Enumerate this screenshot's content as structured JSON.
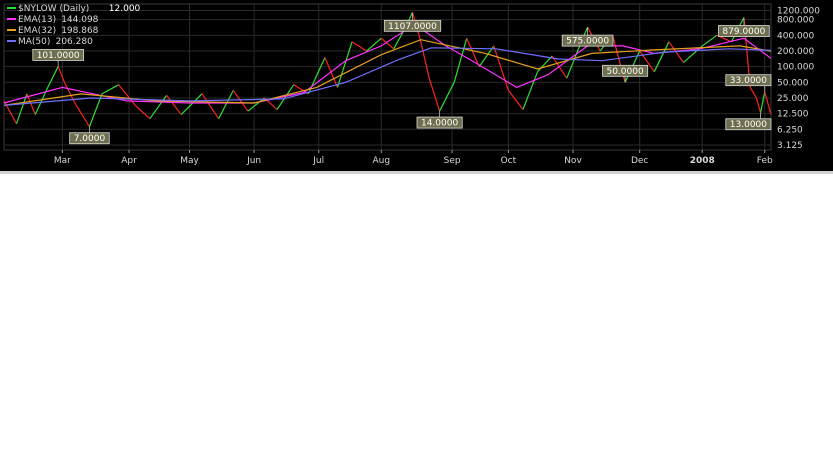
{
  "chart_data": {
    "type": "line",
    "title": "$NYLOW (Daily)",
    "last_value": "12.000",
    "y_scale": "log",
    "ylim": [
      2.5,
      1600
    ],
    "y_ticks": [
      {
        "value": 1200,
        "label": "1200.000"
      },
      {
        "value": 800,
        "label": "800.000"
      },
      {
        "value": 400,
        "label": "400.000"
      },
      {
        "value": 200,
        "label": "200.000"
      },
      {
        "value": 100,
        "label": "100.000"
      },
      {
        "value": 50,
        "label": "50.000"
      },
      {
        "value": 25,
        "label": "25.000"
      },
      {
        "value": 12.5,
        "label": "12.500"
      },
      {
        "value": 6.25,
        "label": "6.250"
      },
      {
        "value": 3.125,
        "label": "3.125"
      }
    ],
    "x_ticks": [
      {
        "date": "2007-03-01",
        "label": "Mar",
        "bold": false
      },
      {
        "date": "2007-04-02",
        "label": "Apr",
        "bold": false
      },
      {
        "date": "2007-05-01",
        "label": "May",
        "bold": false
      },
      {
        "date": "2007-06-01",
        "label": "Jun",
        "bold": false
      },
      {
        "date": "2007-07-02",
        "label": "Jul",
        "bold": false
      },
      {
        "date": "2007-08-01",
        "label": "Aug",
        "bold": false
      },
      {
        "date": "2007-09-04",
        "label": "Sep",
        "bold": false
      },
      {
        "date": "2007-10-01",
        "label": "Oct",
        "bold": false
      },
      {
        "date": "2007-11-01",
        "label": "Nov",
        "bold": false
      },
      {
        "date": "2007-12-03",
        "label": "Dec",
        "bold": false
      },
      {
        "date": "2008-01-02",
        "label": "2008",
        "bold": true
      },
      {
        "date": "2008-02-01",
        "label": "Feb",
        "bold": false
      }
    ],
    "xlim": [
      "2007-02-01",
      "2008-02-04"
    ],
    "legend": [
      {
        "name": "$NYLOW (Daily)",
        "value": "12.000",
        "color": "#2ee02e"
      },
      {
        "name": "EMA(13)",
        "value": "144.098",
        "color": "#ff30ff"
      },
      {
        "name": "EMA(32)",
        "value": "198.868",
        "color": "#e6a020"
      },
      {
        "name": "MA(50)",
        "value": "206.280",
        "color": "#7070ff"
      }
    ],
    "up_color": "#2ee02e",
    "down_color": "#ff2020",
    "annotations": [
      {
        "date": "2007-02-27",
        "value": 101,
        "label": "101.0000"
      },
      {
        "date": "2007-03-14",
        "value": 7,
        "label": "7.0000"
      },
      {
        "date": "2007-08-16",
        "value": 1107,
        "label": "1107.0000"
      },
      {
        "date": "2007-08-29",
        "value": 14,
        "label": "14.0000"
      },
      {
        "date": "2007-11-08",
        "value": 575,
        "label": "575.0000"
      },
      {
        "date": "2007-11-26",
        "value": 50,
        "label": "50.0000"
      },
      {
        "date": "2008-01-22",
        "value": 879,
        "label": "879.0000"
      },
      {
        "date": "2008-02-01",
        "value": 33,
        "label": "33.0000"
      },
      {
        "date": "2008-01-30",
        "value": 13,
        "label": "13.0000"
      }
    ],
    "series": [
      {
        "name": "$NYLOW (Daily)",
        "anchors": [
          [
            "2007-02-01",
            22
          ],
          [
            "2007-02-07",
            8
          ],
          [
            "2007-02-12",
            30
          ],
          [
            "2007-02-16",
            12
          ],
          [
            "2007-02-22",
            40
          ],
          [
            "2007-02-27",
            101
          ],
          [
            "2007-03-02",
            50
          ],
          [
            "2007-03-07",
            20
          ],
          [
            "2007-03-14",
            7
          ],
          [
            "2007-03-20",
            30
          ],
          [
            "2007-03-28",
            45
          ],
          [
            "2007-04-05",
            18
          ],
          [
            "2007-04-12",
            10
          ],
          [
            "2007-04-20",
            28
          ],
          [
            "2007-04-27",
            12
          ],
          [
            "2007-05-07",
            30
          ],
          [
            "2007-05-15",
            10
          ],
          [
            "2007-05-22",
            35
          ],
          [
            "2007-05-29",
            14
          ],
          [
            "2007-06-06",
            25
          ],
          [
            "2007-06-12",
            15
          ],
          [
            "2007-06-20",
            45
          ],
          [
            "2007-06-27",
            30
          ],
          [
            "2007-07-05",
            150
          ],
          [
            "2007-07-11",
            40
          ],
          [
            "2007-07-18",
            300
          ],
          [
            "2007-07-25",
            200
          ],
          [
            "2007-08-01",
            350
          ],
          [
            "2007-08-07",
            220
          ],
          [
            "2007-08-13",
            600
          ],
          [
            "2007-08-16",
            1107
          ],
          [
            "2007-08-20",
            300
          ],
          [
            "2007-08-24",
            60
          ],
          [
            "2007-08-29",
            14
          ],
          [
            "2007-09-05",
            50
          ],
          [
            "2007-09-11",
            350
          ],
          [
            "2007-09-17",
            100
          ],
          [
            "2007-09-24",
            250
          ],
          [
            "2007-10-01",
            35
          ],
          [
            "2007-10-08",
            15
          ],
          [
            "2007-10-15",
            80
          ],
          [
            "2007-10-22",
            160
          ],
          [
            "2007-10-29",
            60
          ],
          [
            "2007-11-05",
            300
          ],
          [
            "2007-11-08",
            575
          ],
          [
            "2007-11-14",
            200
          ],
          [
            "2007-11-20",
            400
          ],
          [
            "2007-11-26",
            50
          ],
          [
            "2007-12-03",
            200
          ],
          [
            "2007-12-10",
            80
          ],
          [
            "2007-12-17",
            300
          ],
          [
            "2007-12-24",
            120
          ],
          [
            "2008-01-02",
            250
          ],
          [
            "2008-01-09",
            400
          ],
          [
            "2008-01-16",
            300
          ],
          [
            "2008-01-22",
            879
          ],
          [
            "2008-01-25",
            40
          ],
          [
            "2008-01-28",
            25
          ],
          [
            "2008-01-30",
            13
          ],
          [
            "2008-02-01",
            33
          ],
          [
            "2008-02-04",
            12
          ]
        ]
      },
      {
        "name": "EMA(13)",
        "anchors": [
          [
            "2007-02-01",
            20
          ],
          [
            "2007-03-01",
            40
          ],
          [
            "2007-04-01",
            22
          ],
          [
            "2007-05-01",
            20
          ],
          [
            "2007-06-01",
            20
          ],
          [
            "2007-06-25",
            32
          ],
          [
            "2007-07-15",
            130
          ],
          [
            "2007-08-01",
            250
          ],
          [
            "2007-08-17",
            650
          ],
          [
            "2007-09-01",
            250
          ],
          [
            "2007-09-15",
            120
          ],
          [
            "2007-10-05",
            40
          ],
          [
            "2007-10-20",
            70
          ],
          [
            "2007-11-08",
            250
          ],
          [
            "2007-11-25",
            250
          ],
          [
            "2007-12-10",
            180
          ],
          [
            "2008-01-01",
            220
          ],
          [
            "2008-01-22",
            350
          ],
          [
            "2008-02-04",
            144
          ]
        ]
      },
      {
        "name": "EMA(32)",
        "anchors": [
          [
            "2007-02-01",
            18
          ],
          [
            "2007-03-10",
            30
          ],
          [
            "2007-04-15",
            22
          ],
          [
            "2007-06-01",
            20
          ],
          [
            "2007-07-01",
            40
          ],
          [
            "2007-08-01",
            170
          ],
          [
            "2007-08-20",
            330
          ],
          [
            "2007-09-20",
            180
          ],
          [
            "2007-10-15",
            90
          ],
          [
            "2007-11-10",
            180
          ],
          [
            "2007-12-10",
            210
          ],
          [
            "2008-01-20",
            250
          ],
          [
            "2008-02-04",
            199
          ]
        ]
      },
      {
        "name": "MA(50)",
        "anchors": [
          [
            "2007-02-01",
            18
          ],
          [
            "2007-03-15",
            25
          ],
          [
            "2007-05-01",
            22
          ],
          [
            "2007-06-15",
            24
          ],
          [
            "2007-07-15",
            50
          ],
          [
            "2007-08-10",
            140
          ],
          [
            "2007-08-25",
            230
          ],
          [
            "2007-09-25",
            220
          ],
          [
            "2007-10-25",
            140
          ],
          [
            "2007-11-15",
            130
          ],
          [
            "2007-12-15",
            190
          ],
          [
            "2008-01-15",
            220
          ],
          [
            "2008-02-04",
            206
          ]
        ]
      }
    ]
  }
}
